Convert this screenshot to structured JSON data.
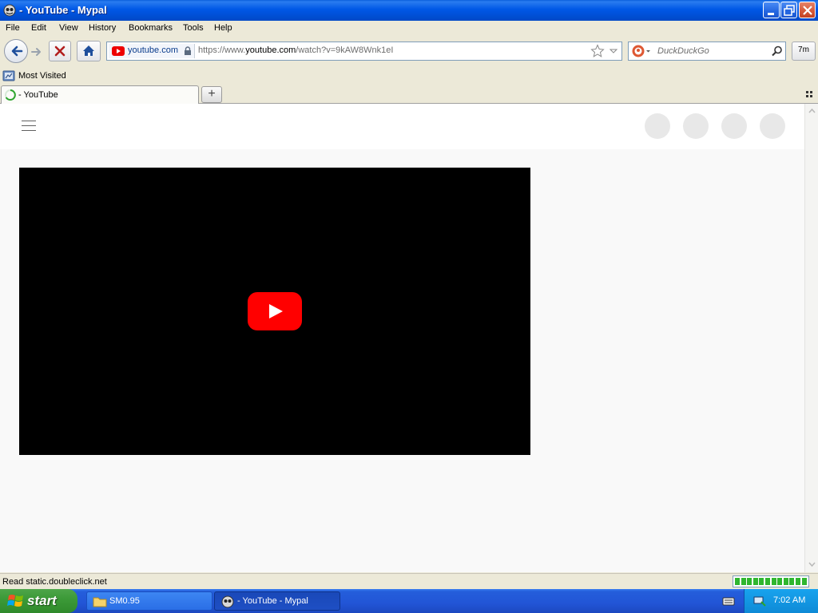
{
  "window": {
    "title": "- YouTube - Mypal"
  },
  "menu": {
    "file": "File",
    "edit": "Edit",
    "view": "View",
    "history": "History",
    "bookmarks": "Bookmarks",
    "tools": "Tools",
    "help": "Help"
  },
  "urlbar": {
    "site_domain": "youtube.com",
    "url_prefix": "https://www.",
    "url_host": "youtube.com",
    "url_path": "/watch?v=9kAW8Wnk1eI"
  },
  "search": {
    "engine": "DuckDuckGo",
    "placeholder": "DuckDuckGo"
  },
  "zoom": {
    "label": "7m"
  },
  "bookmarks": {
    "most_visited": "Most Visited"
  },
  "tabs": [
    {
      "label": "- YouTube",
      "loading": true
    }
  ],
  "status": {
    "text": "Read static.doubleclick.net",
    "progress": 1.0
  },
  "taskbar": {
    "start": "start",
    "items": [
      {
        "label": "SM0.95"
      },
      {
        "label": "- YouTube - Mypal",
        "active": true
      }
    ],
    "clock": "7:02 AM"
  },
  "colors": {
    "youtube_red": "#ff0000",
    "xp_blue": "#0054e3",
    "start_green": "#3c9a38"
  }
}
